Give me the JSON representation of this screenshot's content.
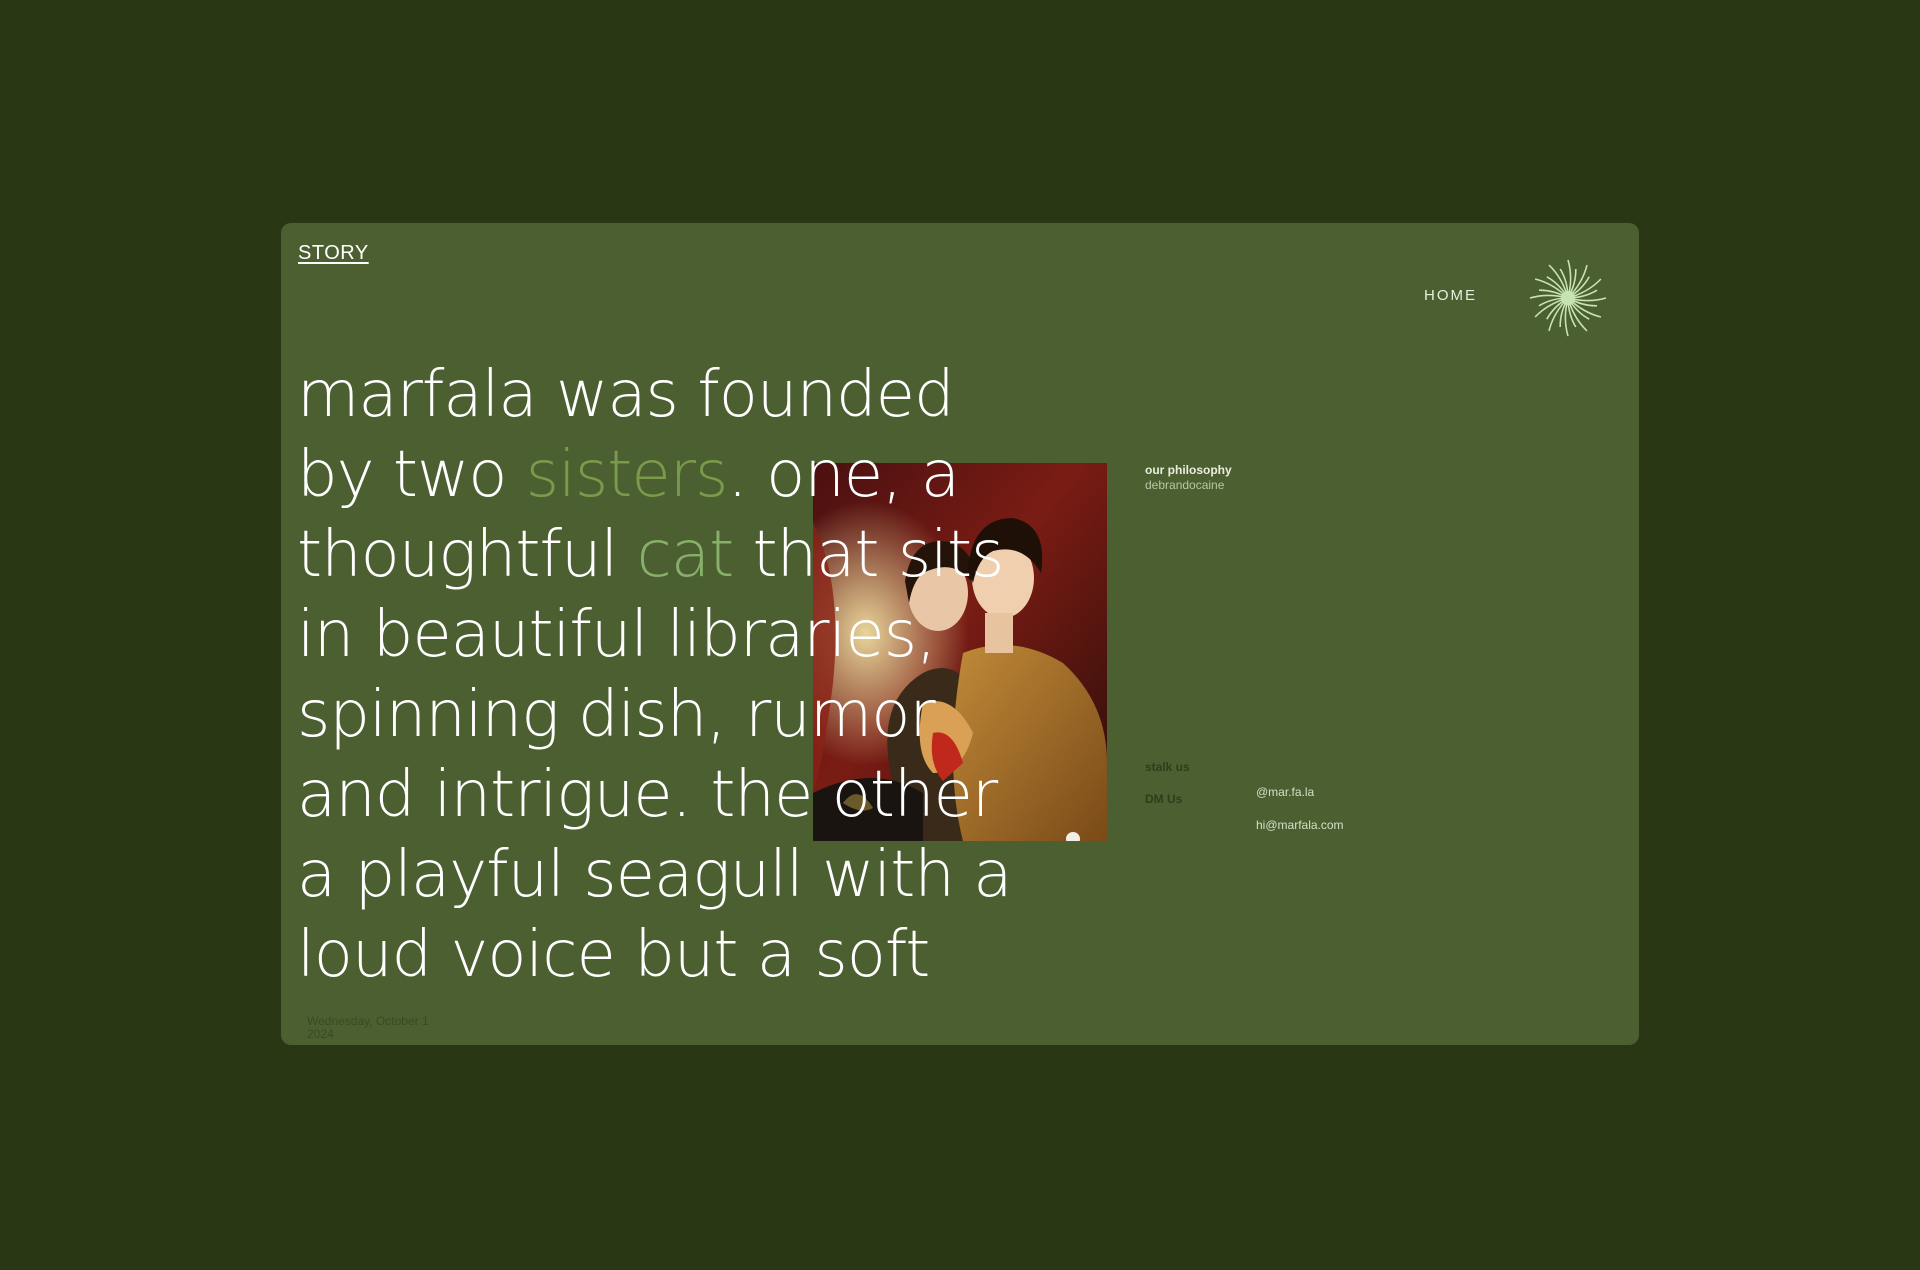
{
  "nav": {
    "story_label": "STORY",
    "home_label": "HOME",
    "logo_icon": "sunburst-icon"
  },
  "headline": {
    "part1": "marfala was founded by two ",
    "sisters": "sisters",
    "part2": ". one, a thoughtful ",
    "cat": "cat",
    "part3": " that sits in beautiful libraries, spinning dish, rumor and intrigue. the other a playful seagull with a loud voice but a soft"
  },
  "date_stamp": {
    "line1": "Wednesday, October 1",
    "line2": "2024"
  },
  "philosophy": {
    "label": "our philosophy",
    "author": "debrandocaine"
  },
  "contact": {
    "stalk_label": "stalk us",
    "dm_label": "DM Us",
    "handle": "@mar.fa.la",
    "email": "hi@marfala.com"
  },
  "colors": {
    "page_bg": "#293714",
    "card_bg": "#4c5f31",
    "accent_sisters": "#7a9a4c",
    "accent_cat": "#88b06a",
    "logo": "#c6e3b0"
  }
}
